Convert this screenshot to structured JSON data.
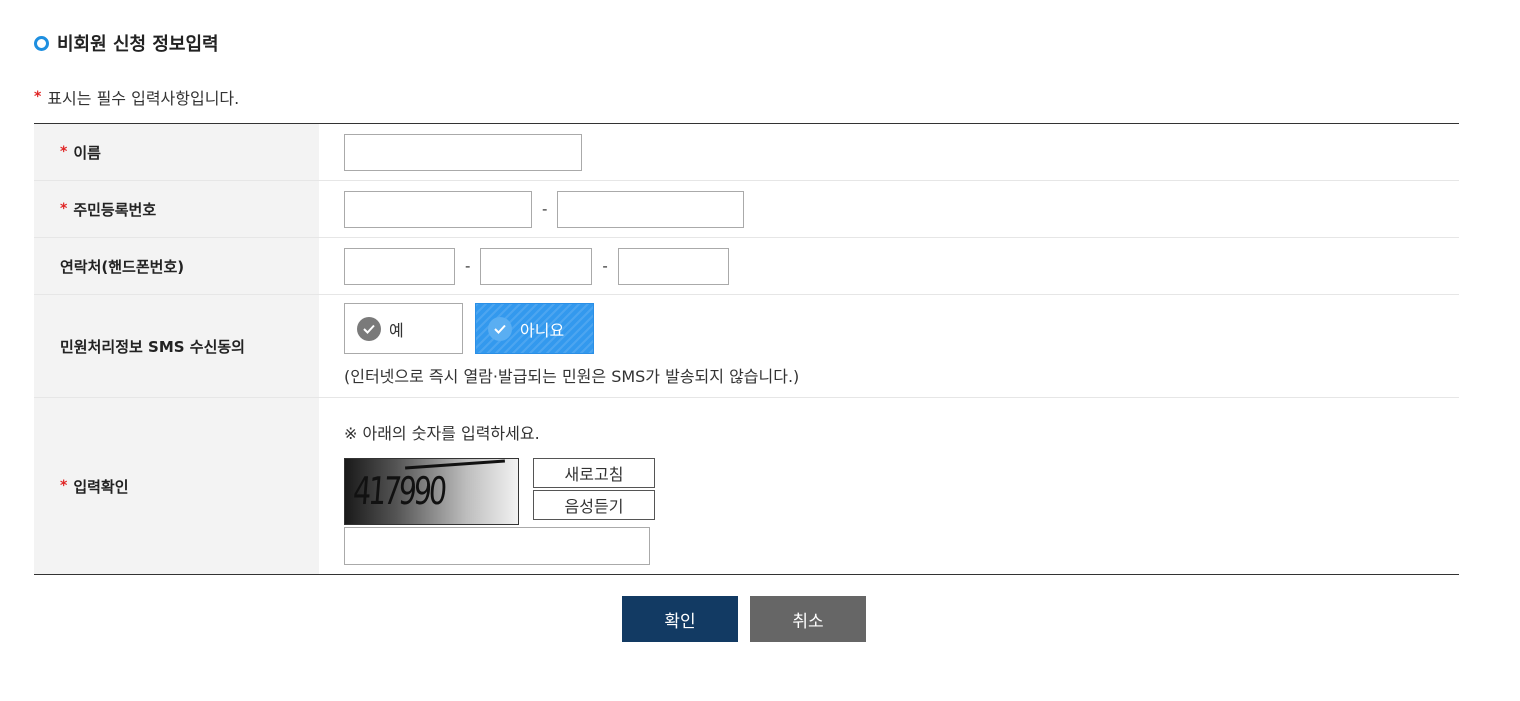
{
  "section": {
    "title": "비회원 신청 정보입력"
  },
  "required_note": {
    "mark": "*",
    "text": "표시는 필수 입력사항입니다."
  },
  "fields": {
    "name": {
      "label": "이름",
      "required": true,
      "value": ""
    },
    "resident_no": {
      "label": "주민등록번호",
      "required": true,
      "part1": "",
      "part2": "",
      "separator": "-"
    },
    "phone": {
      "label": "연락처(핸드폰번호)",
      "required": false,
      "part1": "",
      "part2": "",
      "part3": "",
      "separator": "-"
    },
    "sms_consent": {
      "label": "민원처리정보 SMS 수신동의",
      "options": [
        "예",
        "아니요"
      ],
      "selected": "아니요",
      "note": "(인터넷으로 즉시 열람·발급되는 민원은 SMS가 발송되지 않습니다.)"
    },
    "captcha": {
      "label": "입력확인",
      "required": true,
      "instruction": "※ 아래의 숫자를 입력하세요.",
      "image_text": "417990",
      "refresh_label": "새로고침",
      "audio_label": "음성듣기",
      "value": ""
    }
  },
  "actions": {
    "confirm": "확인",
    "cancel": "취소"
  },
  "colors": {
    "accent": "#3399ee",
    "required": "#e02424",
    "confirm": "#123a63",
    "cancel": "#666666"
  }
}
